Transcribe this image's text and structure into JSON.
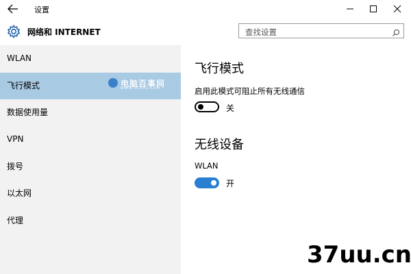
{
  "window": {
    "title": "设置",
    "back_icon": "back-arrow-icon",
    "controls": [
      "minimize-icon",
      "maximize-icon",
      "close-icon"
    ]
  },
  "header": {
    "title": "网络和 INTERNET",
    "icon": "gear-icon",
    "search_placeholder": "查找设置"
  },
  "sidebar": {
    "selected_index": 1,
    "selected_color": "#a9cae3",
    "background_color": "#f2f2f2",
    "items": [
      {
        "label": "WLAN"
      },
      {
        "label": "飞行模式"
      },
      {
        "label": "数据使用量"
      },
      {
        "label": "VPN"
      },
      {
        "label": "拨号"
      },
      {
        "label": "以太网"
      },
      {
        "label": "代理"
      }
    ]
  },
  "watermark": {
    "title": "电脑百事网",
    "subtitle": "WWW.PC841.COM"
  },
  "content": {
    "airplane": {
      "title": "飞行模式",
      "description": "启用此模式可阻止所有无线通信",
      "toggle_state": "off",
      "toggle_label": "关"
    },
    "wireless": {
      "title": "无线设备",
      "device_label": "WLAN",
      "toggle_state": "on",
      "toggle_label": "开",
      "accent_color": "#2b7fd1"
    }
  },
  "site_watermark": "37uu.cn"
}
